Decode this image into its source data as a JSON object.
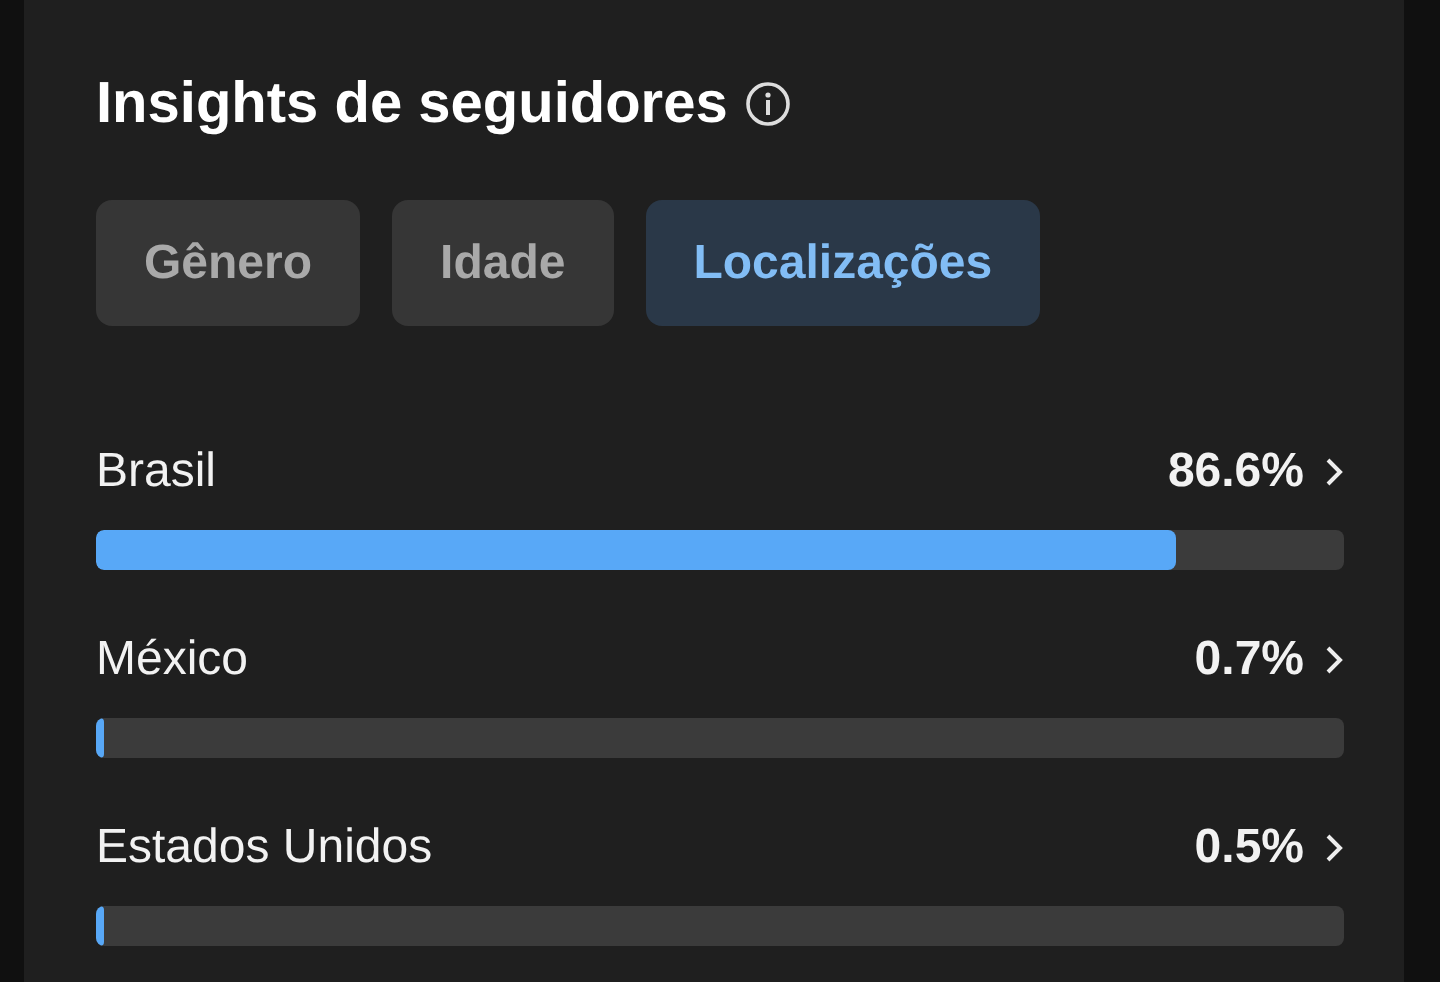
{
  "title": "Insights de seguidores",
  "tabs": [
    {
      "label": "Gênero",
      "selected": false
    },
    {
      "label": "Idade",
      "selected": false
    },
    {
      "label": "Localizações",
      "selected": true
    }
  ],
  "locations": [
    {
      "name": "Brasil",
      "value": "86.6%",
      "level": 0.866
    },
    {
      "name": "México",
      "value": "0.7%",
      "level": 0.007
    },
    {
      "name": "Estados Unidos",
      "value": "0.5%",
      "level": 0.005
    }
  ]
}
